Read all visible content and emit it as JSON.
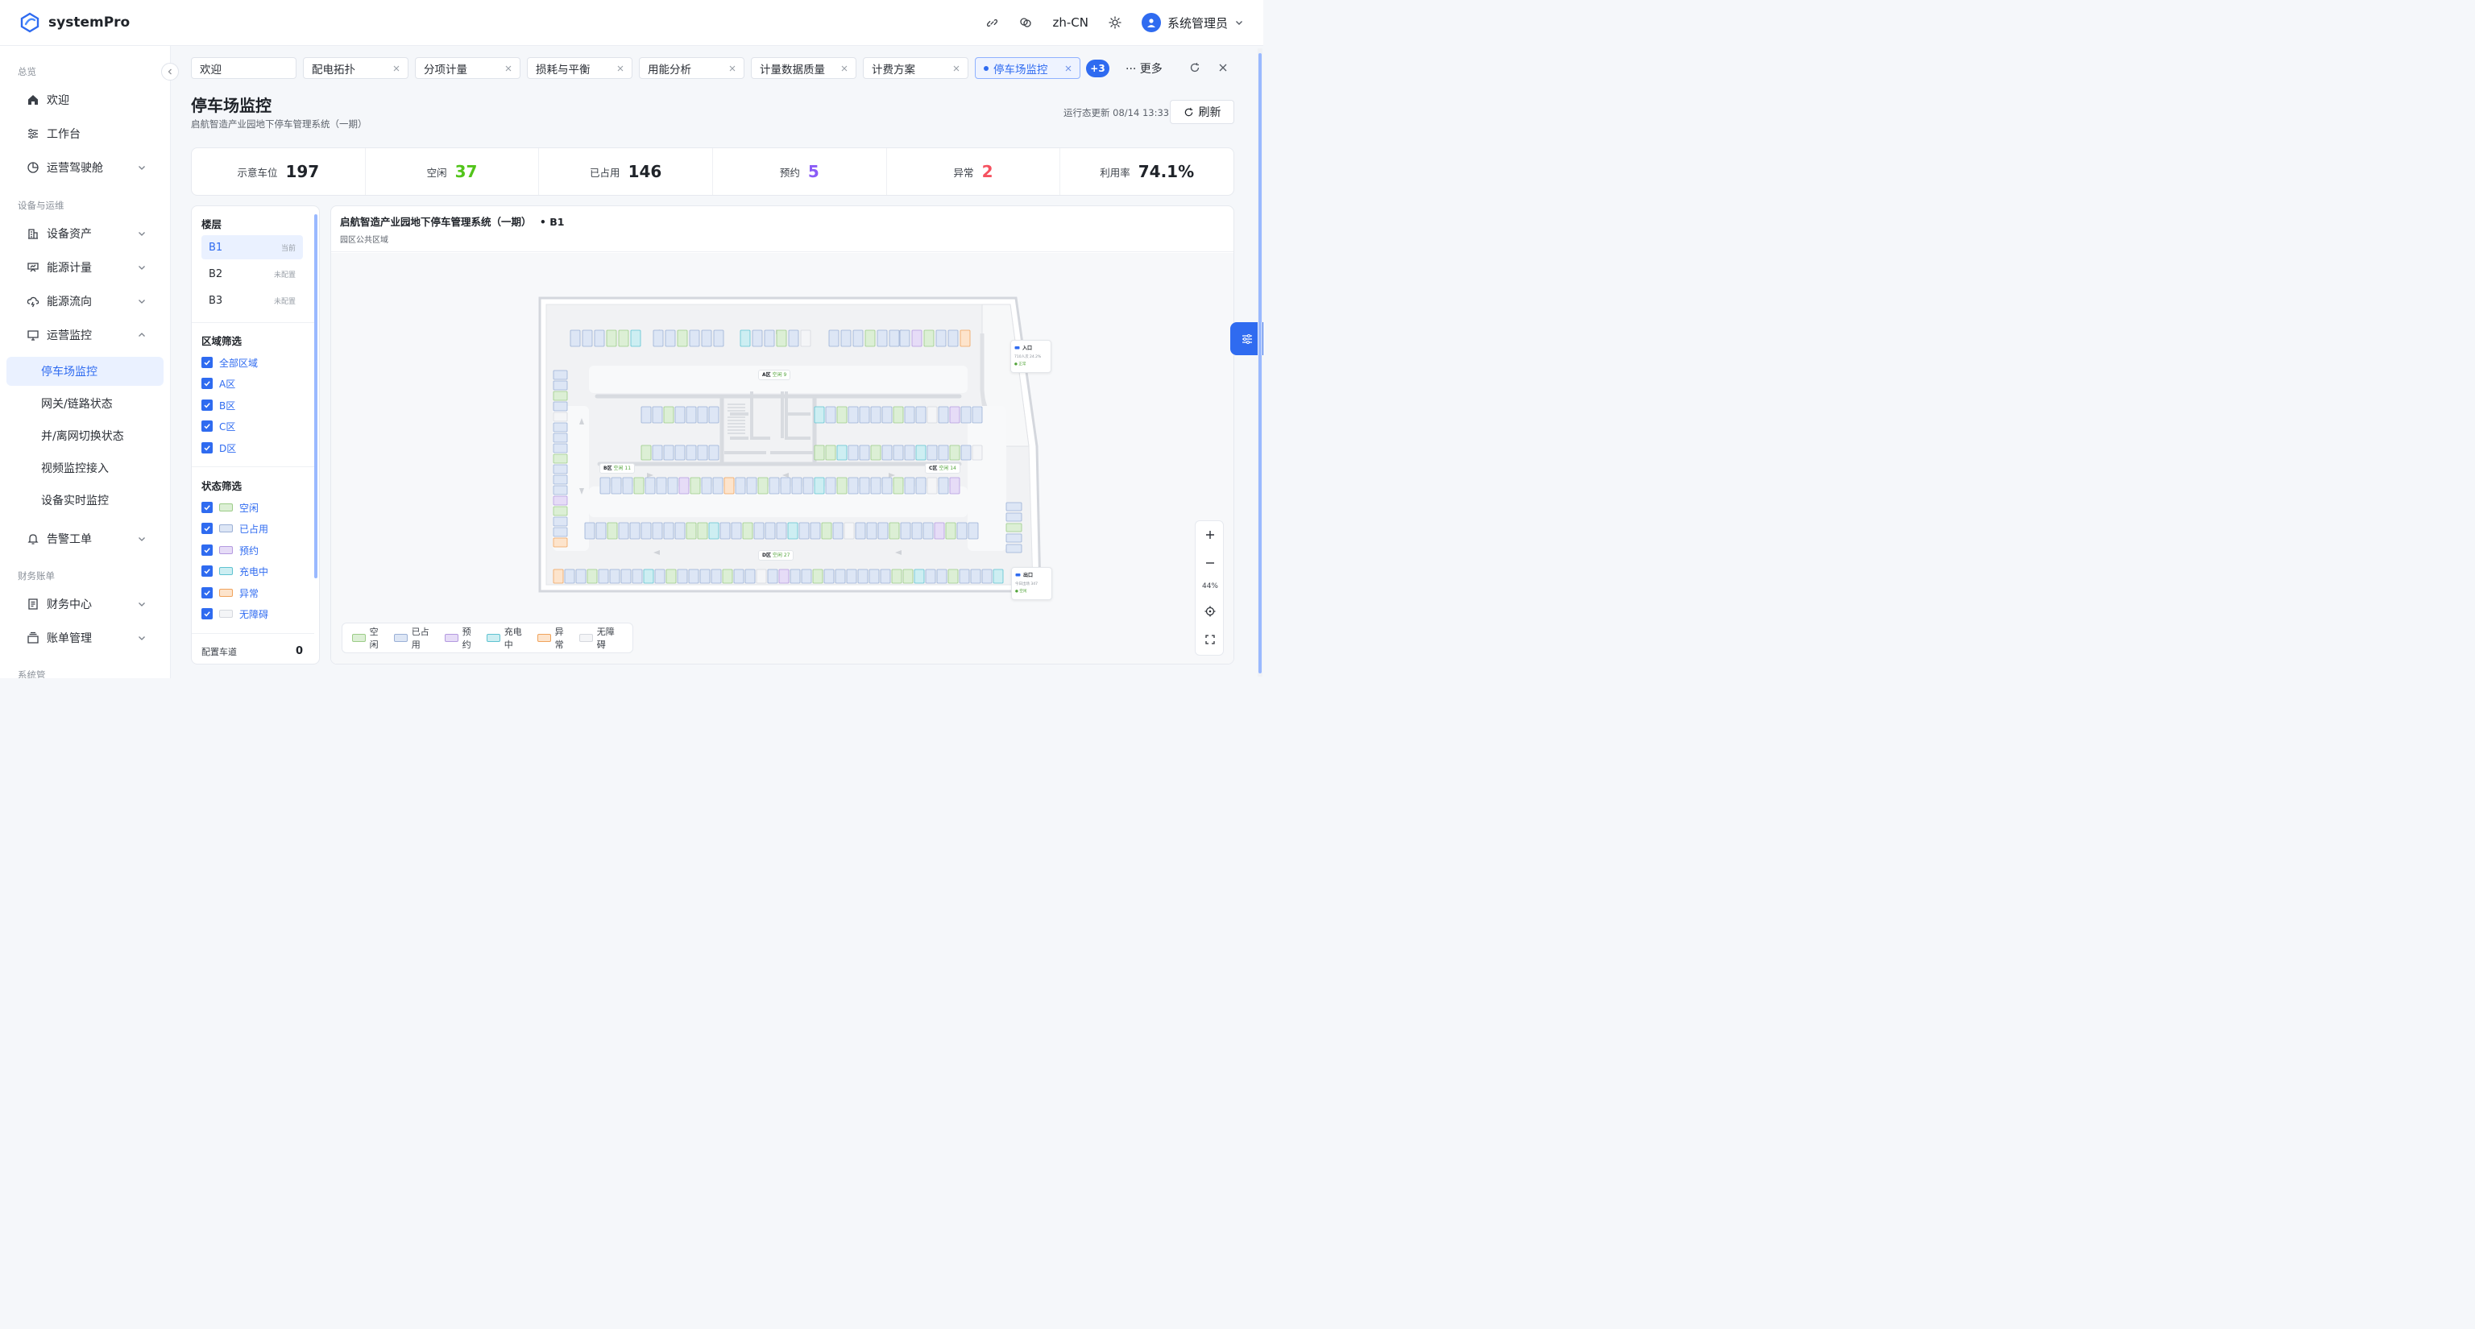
{
  "app": {
    "name": "systemPro"
  },
  "topbar": {
    "language": "zh-CN",
    "user_name": "系统管理员"
  },
  "sidebar": {
    "groups": [
      "总览",
      "设备与运维",
      "财务账单",
      "系统管"
    ],
    "items": [
      {
        "label": "欢迎"
      },
      {
        "label": "工作台"
      },
      {
        "label": "运营驾驶舱"
      },
      {
        "label": "设备资产"
      },
      {
        "label": "能源计量"
      },
      {
        "label": "能源流向"
      },
      {
        "label": "运营监控"
      },
      {
        "label": "告警工单"
      },
      {
        "label": "财务中心"
      },
      {
        "label": "账单管理"
      }
    ],
    "sub_items": [
      {
        "label": "停车场监控"
      },
      {
        "label": "网关/链路状态"
      },
      {
        "label": "并/离网切换状态"
      },
      {
        "label": "视频监控接入"
      },
      {
        "label": "设备实时监控"
      }
    ]
  },
  "tabs": [
    {
      "label": "欢迎"
    },
    {
      "label": "配电拓扑"
    },
    {
      "label": "分项计量"
    },
    {
      "label": "损耗与平衡"
    },
    {
      "label": "用能分析"
    },
    {
      "label": "计量数据质量"
    },
    {
      "label": "计费方案"
    },
    {
      "label": "停车场监控"
    }
  ],
  "tab_overflow": {
    "badge": "+3",
    "more": "··· 更多"
  },
  "page": {
    "title": "停车场监控",
    "subtitle": "启航智造产业园地下停车管理系统（一期）",
    "updated": "运行态更新 08/14 13:33",
    "refresh": "刷新"
  },
  "stats": [
    {
      "label": "示意车位",
      "value": "197",
      "color": "#1f2329"
    },
    {
      "label": "空闲",
      "value": "37",
      "color": "#52c41a"
    },
    {
      "label": "已占用",
      "value": "146",
      "color": "#1f2329"
    },
    {
      "label": "预约",
      "value": "5",
      "color": "#8b5cf6"
    },
    {
      "label": "异常",
      "value": "2",
      "color": "#f5515f"
    },
    {
      "label": "利用率",
      "value": "74.1%",
      "color": "#1f2329"
    }
  ],
  "filters": {
    "floor_title": "楼层",
    "floors": [
      {
        "label": "B1",
        "tag": "当前"
      },
      {
        "label": "B2",
        "tag": "未配置"
      },
      {
        "label": "B3",
        "tag": "未配置"
      }
    ],
    "zone_title": "区域筛选",
    "zones": [
      "全部区域",
      "A区",
      "B区",
      "C区",
      "D区"
    ],
    "status_title": "状态筛选",
    "statuses": [
      {
        "label": "空闲",
        "fill": "#dcefd5",
        "border": "#9ccc88"
      },
      {
        "label": "已占用",
        "fill": "#dde6f5",
        "border": "#9bb0d6"
      },
      {
        "label": "预约",
        "fill": "#e6dcf7",
        "border": "#b49ae0"
      },
      {
        "label": "充电中",
        "fill": "#cdeef2",
        "border": "#5fc3d1"
      },
      {
        "label": "异常",
        "fill": "#fde4cc",
        "border": "#f0a35c"
      },
      {
        "label": "无障碍",
        "fill": "#f4f5f7",
        "border": "#d5d8de"
      }
    ],
    "lane_label": "配置车道",
    "lane_count": "0"
  },
  "map": {
    "title": "启航智造产业园地下停车管理系统（一期）",
    "floor_tag": "• B1",
    "subtitle": "园区公共区域",
    "zone_labels": [
      {
        "zone": "A区",
        "free": "空闲 9"
      },
      {
        "zone": "B区",
        "free": "空闲 11"
      },
      {
        "zone": "C区",
        "free": "空闲 14"
      },
      {
        "zone": "D区",
        "free": "空闲 27"
      }
    ],
    "entrance": {
      "label": "入口",
      "detail": "710人次 24.2%",
      "status": "正常"
    },
    "exit": {
      "label": "出口",
      "detail": "今日出场 347",
      "status": "空闲"
    },
    "zoom": "44%"
  },
  "legend": [
    "空闲",
    "已占用",
    "预约",
    "充电中",
    "异常",
    "无障碍"
  ],
  "colors": {
    "accent": "#2f6bf0"
  }
}
